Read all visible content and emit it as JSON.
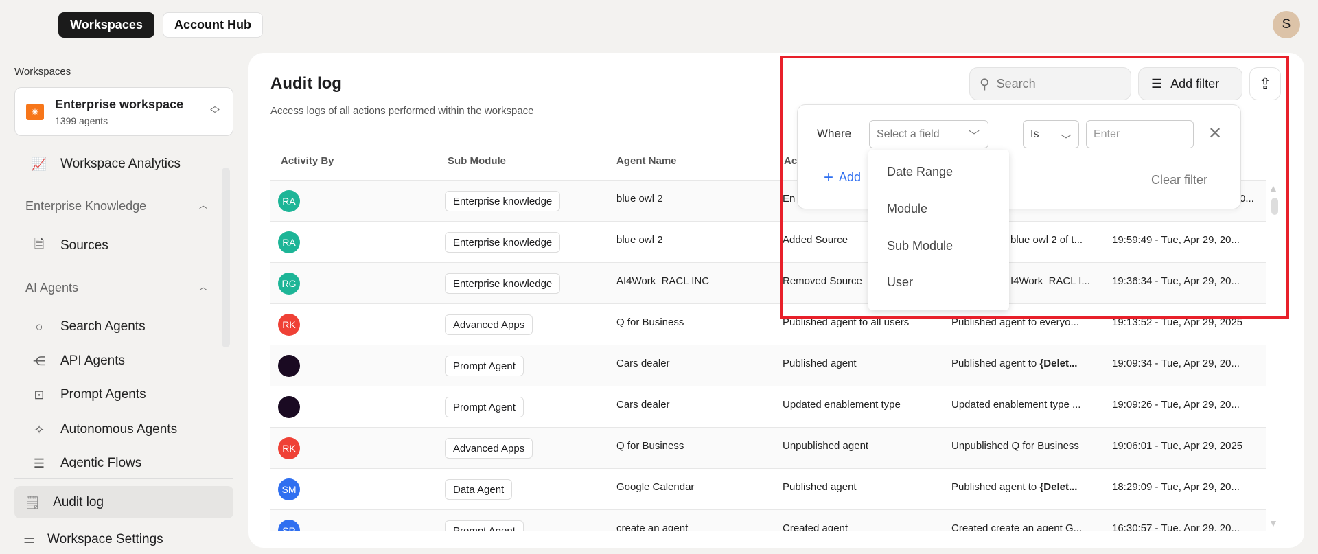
{
  "topnav": {
    "workspaces": "Workspaces",
    "account_hub": "Account Hub",
    "avatar": "S"
  },
  "sidebar": {
    "label": "Workspaces",
    "workspace": {
      "name": "Enterprise workspace",
      "count": "1399 agents"
    },
    "items": [
      {
        "label": "Workspace Analytics",
        "icon": "analytics-icon"
      },
      {
        "section": "Enterprise Knowledge"
      },
      {
        "label": "Sources",
        "icon": "sources-icon"
      },
      {
        "section": "AI Agents"
      },
      {
        "label": "Search Agents",
        "icon": "search-icon"
      },
      {
        "label": "API Agents",
        "icon": "api-icon"
      },
      {
        "label": "Prompt Agents",
        "icon": "prompt-icon"
      },
      {
        "label": "Autonomous Agents",
        "icon": "sparkles-icon"
      },
      {
        "label": "Agentic Flows",
        "icon": "flows-icon"
      }
    ],
    "audit_log": "Audit log",
    "settings": "Workspace Settings"
  },
  "main": {
    "title": "Audit log",
    "subtitle": "Access logs of all actions performed within the workspace",
    "search_placeholder": "Search",
    "add_filter": "Add filter",
    "columns": [
      "Activity By",
      "Sub Module",
      "Agent Name",
      "Ac",
      "",
      ""
    ],
    "rows": [
      {
        "initials": "RA",
        "color": "#1db597",
        "sub": "Enterprise knowledge",
        "agent": "blue owl 2",
        "action": "En",
        "desc": "",
        "time": "0..."
      },
      {
        "initials": "RA",
        "color": "#1db597",
        "sub": "Enterprise knowledge",
        "agent": "blue owl 2",
        "action": "Added Source",
        "desc": "blue owl 2 of t...",
        "time": "19:59:49 - Tue, Apr 29, 20..."
      },
      {
        "initials": "RG",
        "color": "#1db597",
        "sub": "Enterprise knowledge",
        "agent": "AI4Work_RACL INC",
        "action": "Removed Source",
        "desc": "I4Work_RACL I...",
        "time": "19:36:34 - Tue, Apr 29, 20..."
      },
      {
        "initials": "RK",
        "color": "#ef4136",
        "sub": "Advanced Apps",
        "agent": "Q for Business",
        "action": "Published agent to all users",
        "desc": "Published agent to everyo...",
        "time": "19:13:52 - Tue, Apr 29, 2025"
      },
      {
        "initials": "",
        "color": "#1a0a22",
        "sub": "Prompt Agent",
        "agent": "Cars dealer",
        "action": "Published agent",
        "desc": "Published agent to ",
        "desc_bold": "{Delet...",
        "time": "19:09:34 - Tue, Apr 29, 20..."
      },
      {
        "initials": "",
        "color": "#1a0a22",
        "sub": "Prompt Agent",
        "agent": "Cars dealer",
        "action": "Updated enablement type",
        "desc": "Updated enablement type ...",
        "time": "19:09:26 - Tue, Apr 29, 20..."
      },
      {
        "initials": "RK",
        "color": "#ef4136",
        "sub": "Advanced Apps",
        "agent": "Q for Business",
        "action": "Unpublished agent",
        "desc": "Unpublished Q for Business",
        "time": "19:06:01 - Tue, Apr 29, 2025"
      },
      {
        "initials": "SM",
        "color": "#2f6ff0",
        "sub": "Data Agent",
        "agent": "Google Calendar",
        "action": "Published agent",
        "desc": "Published agent to ",
        "desc_bold": "{Delet...",
        "time": "18:29:09 - Tue, Apr 29, 20..."
      },
      {
        "initials": "SR",
        "color": "#2f6ff0",
        "sub": "Prompt Agent",
        "agent": "create an agent",
        "action": "Created agent",
        "desc": "Created create an agent G...",
        "time": "16:30:57 - Tue, Apr 29, 20..."
      }
    ]
  },
  "filter": {
    "where": "Where",
    "field_placeholder": "Select a field",
    "operator": "Is",
    "value_placeholder": "Enter",
    "add": "Add",
    "clear": "Clear filter",
    "options": [
      "Date Range",
      "Module",
      "Sub Module",
      "User"
    ]
  },
  "colors": {
    "highlight": "#e8202a",
    "accent": "#2f6ff0"
  }
}
